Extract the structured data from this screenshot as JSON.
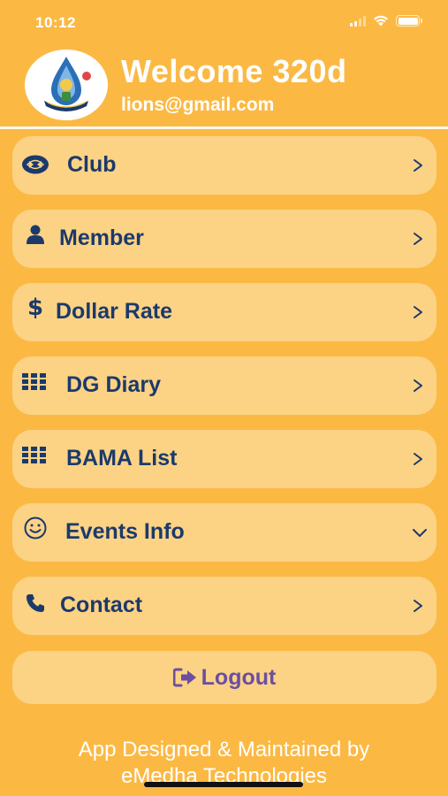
{
  "status_bar": {
    "time": "10:12"
  },
  "header": {
    "welcome": "Welcome 320d",
    "email": "lions@gmail.com"
  },
  "menu": [
    {
      "label": "Club",
      "icon": "club-logo-icon",
      "indicator": "chevron-right"
    },
    {
      "label": "Member",
      "icon": "person-icon",
      "indicator": "chevron-right"
    },
    {
      "label": "Dollar Rate",
      "icon": "dollar-icon",
      "indicator": "chevron-right"
    },
    {
      "label": "DG Diary",
      "icon": "grid-icon",
      "indicator": "chevron-right"
    },
    {
      "label": "BAMA List",
      "icon": "grid-icon",
      "indicator": "chevron-right"
    },
    {
      "label": "Events Info",
      "icon": "smiley-icon",
      "indicator": "chevron-down"
    },
    {
      "label": "Contact",
      "icon": "phone-icon",
      "indicator": "chevron-right"
    }
  ],
  "logout": {
    "label": "Logout",
    "icon": "sign-out-icon"
  },
  "footer": {
    "line1": "App Designed & Maintained by",
    "line2": "eMedha Technologies"
  },
  "colors": {
    "background": "#FBB944",
    "card": "#FCD285",
    "text_primary": "#1B3A6B",
    "logout_text": "#6B4FA0"
  }
}
